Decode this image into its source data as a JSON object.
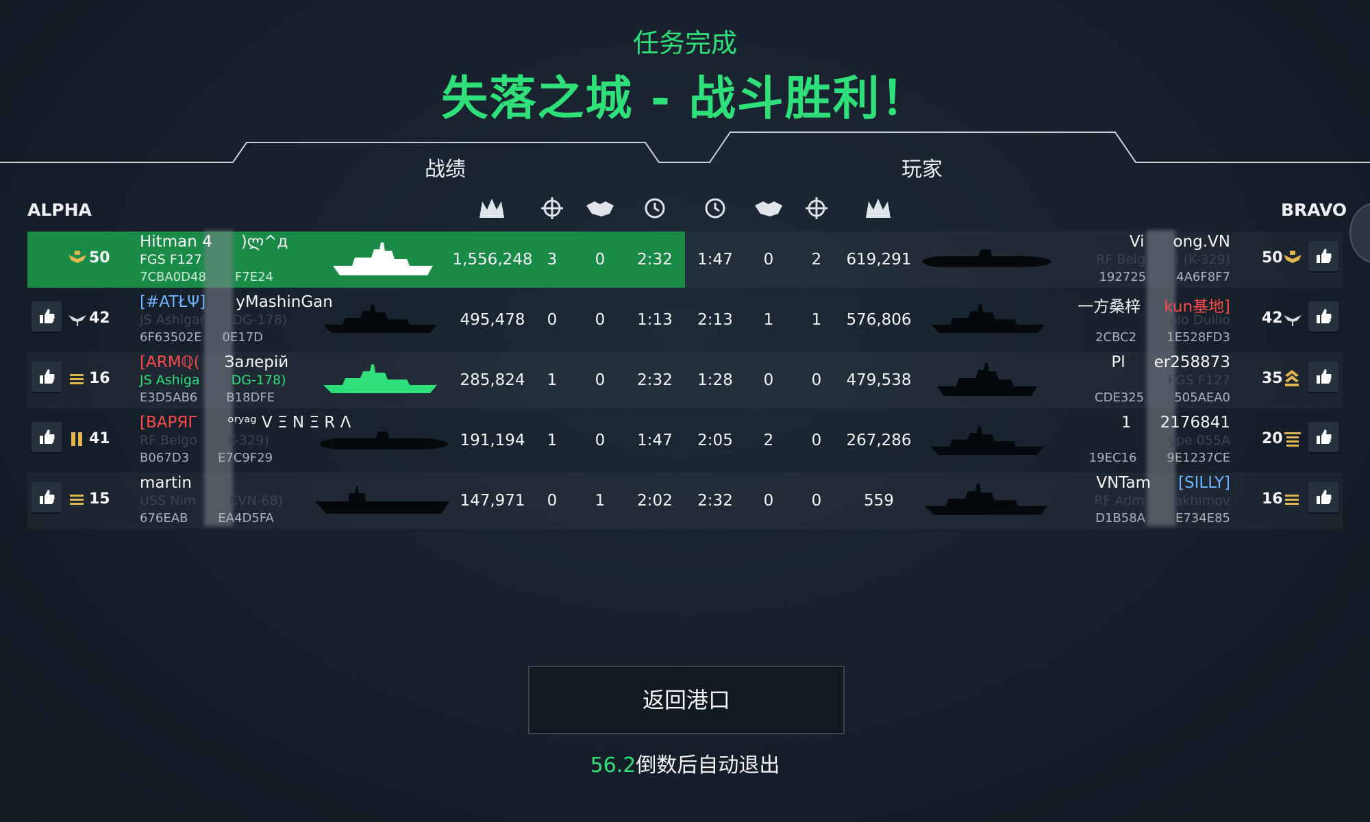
{
  "header": {
    "subtitle": "任务完成",
    "title": "失落之城 - 战斗胜利！"
  },
  "tabs": {
    "left": "战绩",
    "right": "玩家"
  },
  "teams": {
    "left": "ALPHA",
    "right": "BRAVO"
  },
  "columns": [
    "damage-icon",
    "crosshair-icon",
    "handshake-icon",
    "clock-icon"
  ],
  "alpha": [
    {
      "name_a": "Hitman 4",
      "name_b": ")ლ^д",
      "ship": "FGS F127",
      "code_a": "7CBA0D48",
      "code_b": "F7E24",
      "level": "50",
      "rank_icon": "eagle-rank-icon",
      "damage": "1,556,248",
      "kills": "3",
      "assists": "0",
      "time": "2:32"
    },
    {
      "tag": "[#ATŁΨ]",
      "name_b": "yMashinGan",
      "ship_a": "JS Ashigar",
      "ship_b": "DG-178)",
      "code_a": "6F63502E",
      "code_b": "0E17D",
      "level": "42",
      "rank_icon": "wings-rank-icon",
      "damage": "495,478",
      "kills": "0",
      "assists": "0",
      "time": "1:13"
    },
    {
      "tag": "[ARMℚ(",
      "name_b": "Залерій",
      "ship_a": "JS Ashiga",
      "ship_b": "DG-178)",
      "code_a": "E3D5AB6",
      "code_b": "B18DFE",
      "level": "16",
      "rank_icon": "bars-rank-icon",
      "damage": "285,824",
      "kills": "1",
      "assists": "0",
      "time": "2:32"
    },
    {
      "tag": "[ВАРЯГ",
      "name_b": "ᵒʳʸᵃᵍ V Ξ N Ξ R Λ",
      "ship_a": "RF Belgo",
      "ship_b": "K-329)",
      "code_a": "B067D3",
      "code_b": "E7C9F29",
      "level": "41",
      "rank_icon": "bars-rank-icon",
      "damage": "191,194",
      "kills": "1",
      "assists": "0",
      "time": "1:47"
    },
    {
      "name_a": "martin",
      "ship_a": "USS Nim",
      "ship_b": "CVN-68)",
      "code_a": "676EAB",
      "code_b": "EA4D5FA",
      "level": "15",
      "rank_icon": "bars-rank-icon",
      "damage": "147,971",
      "kills": "0",
      "assists": "1",
      "time": "2:02"
    }
  ],
  "bravo": [
    {
      "name_a": "Vi",
      "name_b": "ong.VN",
      "ship_a": "RF Belg",
      "ship_b": "l (K-329)",
      "code_a": "192725",
      "code_b": "4A6F8F7",
      "level": "50",
      "rank_icon": "eagle-rank-icon",
      "damage": "619,291",
      "kills": "2",
      "assists": "0",
      "time": "1:47"
    },
    {
      "name_a": "一方桑梓",
      "tag": "kun基地]",
      "ship_a": "",
      "ship_b": "aio Duilio",
      "code_a": "2CBC2",
      "code_b": "1E528FD3",
      "level": "42",
      "rank_icon": "wings-rank-icon",
      "damage": "576,806",
      "kills": "1",
      "assists": "1",
      "time": "2:13"
    },
    {
      "name_a": "Pl",
      "name_b": "er258873",
      "ship_a": "",
      "ship_b": "FGS F127",
      "code_a": "CDE325",
      "code_b": "505AEA0",
      "level": "35",
      "rank_icon": "chevron-rank-icon",
      "damage": "479,538",
      "kills": "0",
      "assists": "0",
      "time": "1:28"
    },
    {
      "name_a": "1",
      "name_b": "2176841",
      "ship_a": "",
      "ship_b": "ype 055A",
      "code_a": "19EC16",
      "code_b": "9E1237CE",
      "level": "20",
      "rank_icon": "bars-rank-icon",
      "damage": "267,286",
      "kills": "0",
      "assists": "2",
      "time": "2:05"
    },
    {
      "name_a": "VNTam",
      "tag": "[SILLY]",
      "ship_a": "RF Adm",
      "ship_b": "akhimov",
      "code_a": "D1B58A",
      "code_b": "E734E85",
      "level": "16",
      "rank_icon": "bars-rank-icon",
      "damage": "559",
      "kills": "0",
      "assists": "0",
      "time": "2:32"
    }
  ],
  "footer": {
    "button": "返回港口",
    "seconds": "56.2",
    "countdown_text": "倒数后自动退出"
  },
  "colors": {
    "accent_green": "#2fe07a",
    "highlight_row": "#1a8a47",
    "tag_blue": "#6fb4ff",
    "tag_red": "#ff4a4a"
  }
}
